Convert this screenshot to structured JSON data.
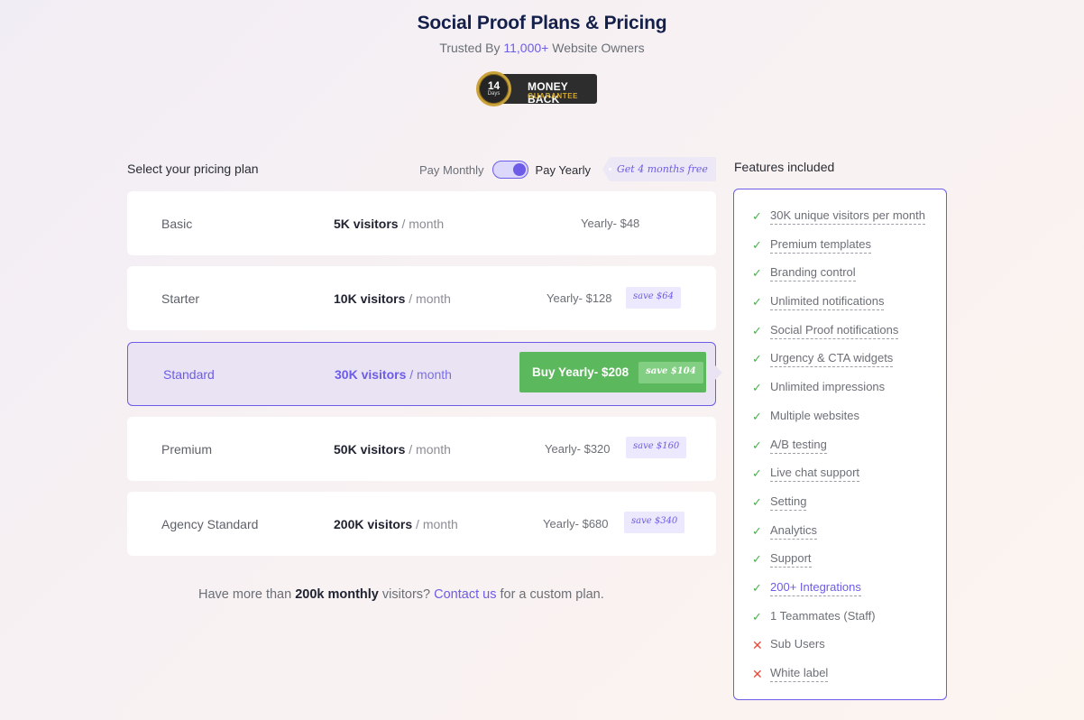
{
  "header": {
    "title": "Social Proof Plans & Pricing",
    "subtitle_prefix": "Trusted By ",
    "subtitle_highlight": "11,000+",
    "subtitle_suffix": " Website Owners"
  },
  "guarantee_badge": {
    "days_number": "14",
    "days_label": "Days",
    "line1": "MONEY BACK",
    "line2": "GUARANTEE"
  },
  "plan_selector": {
    "label": "Select your pricing plan",
    "pay_monthly": "Pay Monthly",
    "pay_yearly": "Pay Yearly",
    "billing_toggle": "yearly",
    "promo_tag": "Get 4 months free"
  },
  "plans": [
    {
      "name": "Basic",
      "visitors": "5K visitors",
      "period": " / month",
      "price": "Yearly- $48",
      "save": null,
      "selected": false
    },
    {
      "name": "Starter",
      "visitors": "10K visitors",
      "period": " / month",
      "price": "Yearly- $128",
      "save": "save $64",
      "selected": false
    },
    {
      "name": "Standard",
      "visitors": "30K visitors",
      "period": " / month",
      "price": "Buy Yearly- $208",
      "save": "save $104",
      "selected": true
    },
    {
      "name": "Premium",
      "visitors": "50K visitors",
      "period": " / month",
      "price": "Yearly- $320",
      "save": "save $160",
      "selected": false
    },
    {
      "name": "Agency Standard",
      "visitors": "200K visitors",
      "period": " / month",
      "price": "Yearly- $680",
      "save": "save $340",
      "selected": false
    }
  ],
  "custom_note": {
    "prefix": "Have more than ",
    "bold": "200k monthly",
    "middle": " visitors? ",
    "link": "Contact us",
    "suffix": " for a custom plan."
  },
  "features": {
    "label": "Features included",
    "items": [
      {
        "text": "30K unique visitors per month",
        "included": true,
        "dashed": true
      },
      {
        "text": "Premium templates",
        "included": true,
        "dashed": true
      },
      {
        "text": "Branding control",
        "included": true,
        "dashed": true
      },
      {
        "text": "Unlimited notifications",
        "included": true,
        "dashed": true
      },
      {
        "text": "Social Proof notifications",
        "included": true,
        "dashed": true
      },
      {
        "text": "Urgency & CTA widgets",
        "included": true,
        "dashed": true
      },
      {
        "text": "Unlimited impressions",
        "included": true,
        "dashed": false
      },
      {
        "text": "Multiple websites",
        "included": true,
        "dashed": false
      },
      {
        "text": "A/B testing",
        "included": true,
        "dashed": true
      },
      {
        "text": "Live chat support",
        "included": true,
        "dashed": true
      },
      {
        "text": "Setting",
        "included": true,
        "dashed": true
      },
      {
        "text": "Analytics",
        "included": true,
        "dashed": true
      },
      {
        "text": "Support",
        "included": true,
        "dashed": true
      },
      {
        "text": "200+ Integrations",
        "included": true,
        "dashed": true,
        "accent": true
      },
      {
        "text": "1 Teammates (Staff)",
        "included": true,
        "dashed": false
      },
      {
        "text": "Sub Users",
        "included": false,
        "dashed": false
      },
      {
        "text": "White label",
        "included": false,
        "dashed": true
      }
    ]
  },
  "colors": {
    "accent": "#6c5ce7",
    "title": "#14204a",
    "buy_button": "#5cb85c",
    "check": "#4caf50",
    "cross": "#e74c3c"
  },
  "icons": {
    "check": "check-icon",
    "cross": "cross-icon"
  }
}
